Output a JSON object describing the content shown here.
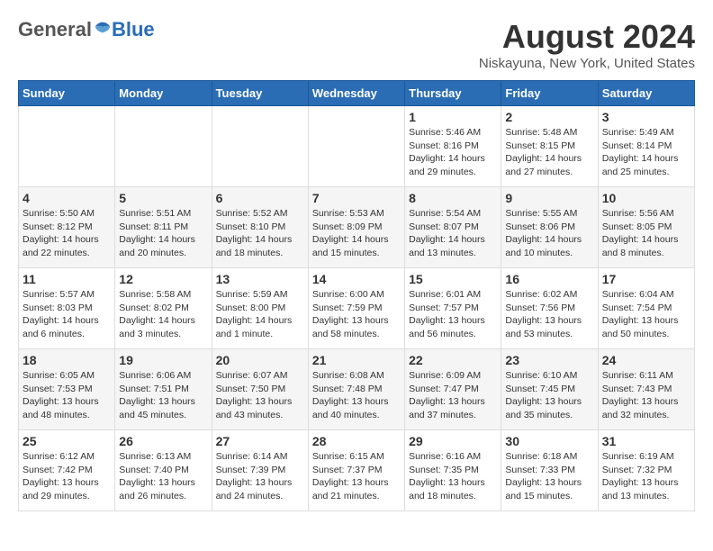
{
  "logo": {
    "general": "General",
    "blue": "Blue"
  },
  "title": {
    "month_year": "August 2024",
    "location": "Niskayuna, New York, United States"
  },
  "weekdays": [
    "Sunday",
    "Monday",
    "Tuesday",
    "Wednesday",
    "Thursday",
    "Friday",
    "Saturday"
  ],
  "rows": [
    [
      {
        "day": "",
        "content": ""
      },
      {
        "day": "",
        "content": ""
      },
      {
        "day": "",
        "content": ""
      },
      {
        "day": "",
        "content": ""
      },
      {
        "day": "1",
        "content": "Sunrise: 5:46 AM\nSunset: 8:16 PM\nDaylight: 14 hours\nand 29 minutes."
      },
      {
        "day": "2",
        "content": "Sunrise: 5:48 AM\nSunset: 8:15 PM\nDaylight: 14 hours\nand 27 minutes."
      },
      {
        "day": "3",
        "content": "Sunrise: 5:49 AM\nSunset: 8:14 PM\nDaylight: 14 hours\nand 25 minutes."
      }
    ],
    [
      {
        "day": "4",
        "content": "Sunrise: 5:50 AM\nSunset: 8:12 PM\nDaylight: 14 hours\nand 22 minutes."
      },
      {
        "day": "5",
        "content": "Sunrise: 5:51 AM\nSunset: 8:11 PM\nDaylight: 14 hours\nand 20 minutes."
      },
      {
        "day": "6",
        "content": "Sunrise: 5:52 AM\nSunset: 8:10 PM\nDaylight: 14 hours\nand 18 minutes."
      },
      {
        "day": "7",
        "content": "Sunrise: 5:53 AM\nSunset: 8:09 PM\nDaylight: 14 hours\nand 15 minutes."
      },
      {
        "day": "8",
        "content": "Sunrise: 5:54 AM\nSunset: 8:07 PM\nDaylight: 14 hours\nand 13 minutes."
      },
      {
        "day": "9",
        "content": "Sunrise: 5:55 AM\nSunset: 8:06 PM\nDaylight: 14 hours\nand 10 minutes."
      },
      {
        "day": "10",
        "content": "Sunrise: 5:56 AM\nSunset: 8:05 PM\nDaylight: 14 hours\nand 8 minutes."
      }
    ],
    [
      {
        "day": "11",
        "content": "Sunrise: 5:57 AM\nSunset: 8:03 PM\nDaylight: 14 hours\nand 6 minutes."
      },
      {
        "day": "12",
        "content": "Sunrise: 5:58 AM\nSunset: 8:02 PM\nDaylight: 14 hours\nand 3 minutes."
      },
      {
        "day": "13",
        "content": "Sunrise: 5:59 AM\nSunset: 8:00 PM\nDaylight: 14 hours\nand 1 minute."
      },
      {
        "day": "14",
        "content": "Sunrise: 6:00 AM\nSunset: 7:59 PM\nDaylight: 13 hours\nand 58 minutes."
      },
      {
        "day": "15",
        "content": "Sunrise: 6:01 AM\nSunset: 7:57 PM\nDaylight: 13 hours\nand 56 minutes."
      },
      {
        "day": "16",
        "content": "Sunrise: 6:02 AM\nSunset: 7:56 PM\nDaylight: 13 hours\nand 53 minutes."
      },
      {
        "day": "17",
        "content": "Sunrise: 6:04 AM\nSunset: 7:54 PM\nDaylight: 13 hours\nand 50 minutes."
      }
    ],
    [
      {
        "day": "18",
        "content": "Sunrise: 6:05 AM\nSunset: 7:53 PM\nDaylight: 13 hours\nand 48 minutes."
      },
      {
        "day": "19",
        "content": "Sunrise: 6:06 AM\nSunset: 7:51 PM\nDaylight: 13 hours\nand 45 minutes."
      },
      {
        "day": "20",
        "content": "Sunrise: 6:07 AM\nSunset: 7:50 PM\nDaylight: 13 hours\nand 43 minutes."
      },
      {
        "day": "21",
        "content": "Sunrise: 6:08 AM\nSunset: 7:48 PM\nDaylight: 13 hours\nand 40 minutes."
      },
      {
        "day": "22",
        "content": "Sunrise: 6:09 AM\nSunset: 7:47 PM\nDaylight: 13 hours\nand 37 minutes."
      },
      {
        "day": "23",
        "content": "Sunrise: 6:10 AM\nSunset: 7:45 PM\nDaylight: 13 hours\nand 35 minutes."
      },
      {
        "day": "24",
        "content": "Sunrise: 6:11 AM\nSunset: 7:43 PM\nDaylight: 13 hours\nand 32 minutes."
      }
    ],
    [
      {
        "day": "25",
        "content": "Sunrise: 6:12 AM\nSunset: 7:42 PM\nDaylight: 13 hours\nand 29 minutes."
      },
      {
        "day": "26",
        "content": "Sunrise: 6:13 AM\nSunset: 7:40 PM\nDaylight: 13 hours\nand 26 minutes."
      },
      {
        "day": "27",
        "content": "Sunrise: 6:14 AM\nSunset: 7:39 PM\nDaylight: 13 hours\nand 24 minutes."
      },
      {
        "day": "28",
        "content": "Sunrise: 6:15 AM\nSunset: 7:37 PM\nDaylight: 13 hours\nand 21 minutes."
      },
      {
        "day": "29",
        "content": "Sunrise: 6:16 AM\nSunset: 7:35 PM\nDaylight: 13 hours\nand 18 minutes."
      },
      {
        "day": "30",
        "content": "Sunrise: 6:18 AM\nSunset: 7:33 PM\nDaylight: 13 hours\nand 15 minutes."
      },
      {
        "day": "31",
        "content": "Sunrise: 6:19 AM\nSunset: 7:32 PM\nDaylight: 13 hours\nand 13 minutes."
      }
    ]
  ]
}
